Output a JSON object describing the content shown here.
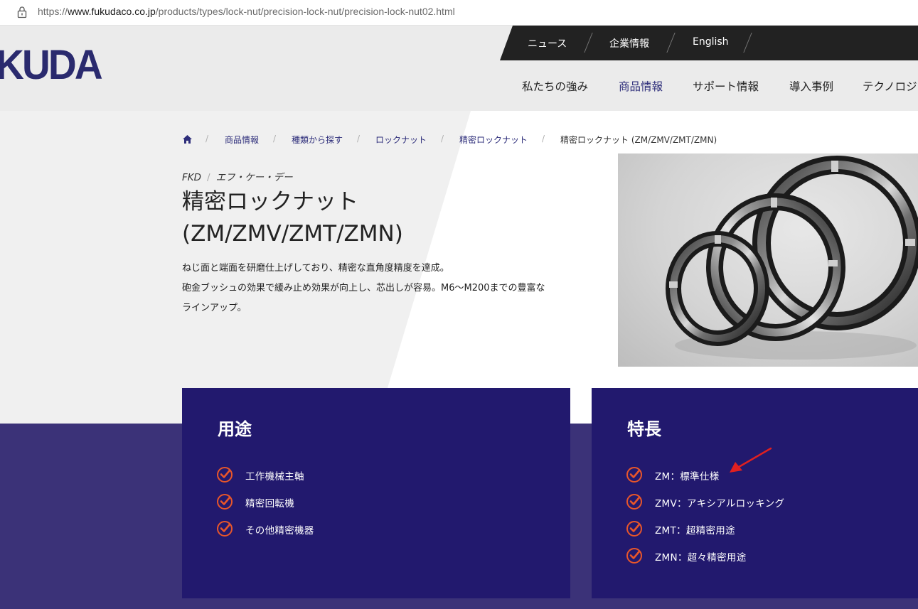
{
  "browser": {
    "url_prefix": "https://",
    "url_host": "www.fukudaco.co.jp",
    "url_path": "/products/types/lock-nut/precision-lock-nut/precision-lock-nut02.html"
  },
  "header": {
    "logo_text": "KUDA",
    "top_links": [
      "ニュース",
      "企業情報",
      "English"
    ],
    "nav": [
      "私たちの強み",
      "商品情報",
      "サポート情報",
      "導入事例",
      "テクノロジ"
    ],
    "nav_active": "商品情報"
  },
  "breadcrumb": [
    "商品情報",
    "種類から探す",
    "ロックナット",
    "精密ロックナット",
    "精密ロックナット (ZM/ZMV/ZMT/ZMN)"
  ],
  "product": {
    "brand": "FKD",
    "brand_kana": "エフ・ケー・デー",
    "title_line1": "精密ロックナット",
    "title_line2": "(ZM/ZMV/ZMT/ZMN)",
    "desc_line1": "ねじ面と端面を研磨仕上げしており、精密な直角度精度を達成。",
    "desc_line2": "砲金ブッシュの効果で緩み止め効果が向上し、芯出しが容易。M6〜M200までの豊富な",
    "desc_line3": "ラインアップ。"
  },
  "uses": {
    "heading": "用途",
    "items": [
      "工作機械主軸",
      "精密回転機",
      "その他精密機器"
    ]
  },
  "features": {
    "heading": "特長",
    "items": [
      "ZM：標準仕様",
      "ZMV：アキシアルロッキング",
      "ZMT：超精密用途",
      "ZMN：超々精密用途"
    ]
  },
  "colors": {
    "navy": "#22196e",
    "band": "#3b3278",
    "check": "#e8562a",
    "annotation_arrow": "#e02020"
  }
}
